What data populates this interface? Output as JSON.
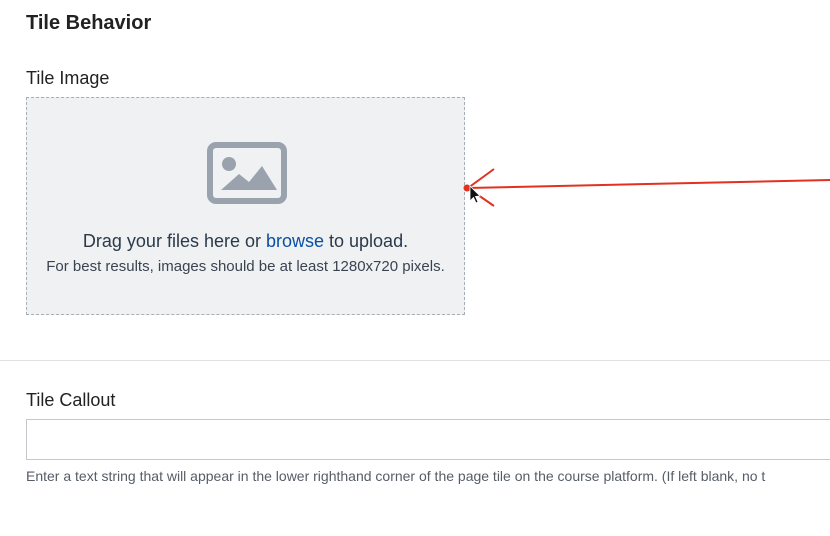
{
  "section": {
    "title": "Tile Behavior"
  },
  "tile_image": {
    "label": "Tile Image",
    "icon": "image-icon",
    "drag_prefix": "Drag your files here or ",
    "browse_label": "browse",
    "drag_suffix": " to upload.",
    "hint": "For best results, images should be at least 1280x720 pixels."
  },
  "tile_callout": {
    "label": "Tile Callout",
    "value": "",
    "placeholder": "",
    "help": "Enter a text string that will appear in the lower righthand corner of the page tile on the course platform. (If left blank, no t"
  },
  "colors": {
    "annotation_arrow": "#e0321e",
    "link": "#0b4fa3",
    "dropzone_bg": "#eff1f3"
  }
}
